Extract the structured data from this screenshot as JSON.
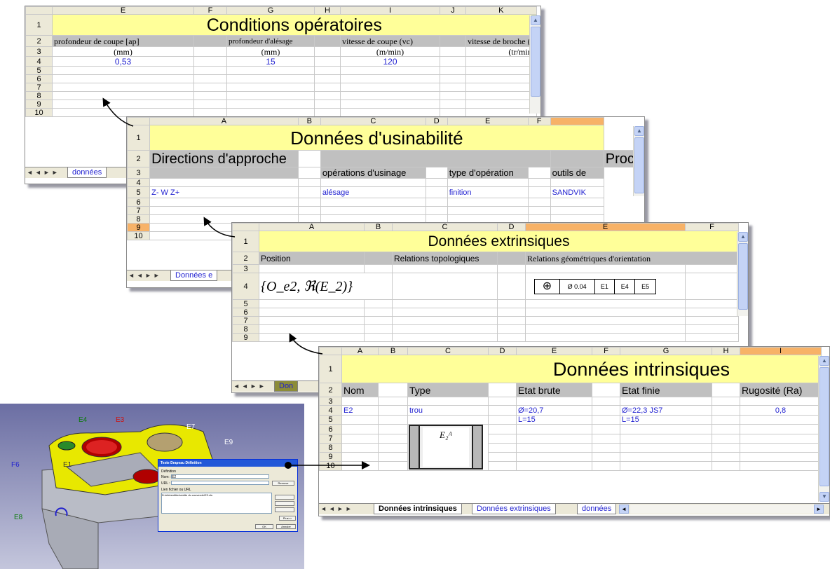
{
  "sheet1": {
    "columns": [
      "E",
      "F",
      "G",
      "H",
      "I",
      "J",
      "K"
    ],
    "rows": [
      "1",
      "2",
      "3",
      "4",
      "5",
      "6",
      "7",
      "8",
      "9",
      "10"
    ],
    "title": "Conditions opératoires",
    "headers": [
      "profondeur de coupe [ap]",
      "profondeur d'alésage",
      "vitesse de coupe (vc)",
      "vitesse de broche (n"
    ],
    "units": [
      "(mm)",
      "(mm)",
      "(m/min)",
      "(tr/min)"
    ],
    "values": [
      "0,53",
      "15",
      "120",
      ""
    ],
    "tab_label": "données"
  },
  "sheet2": {
    "columns": [
      "A",
      "B",
      "C",
      "D",
      "E",
      "F",
      ""
    ],
    "rows": [
      "1",
      "2",
      "3",
      "4",
      "5",
      "6",
      "7",
      "8",
      "9",
      "10"
    ],
    "title": "Données d'usinabilité",
    "directions_label": "Directions d'approche",
    "process_label": "Proce",
    "subheaders": [
      "opérations d'usinage",
      "type d'opération",
      "outils de"
    ],
    "row5": [
      "Z- W Z+",
      "alésage",
      "finition",
      "SANDVIK"
    ],
    "tab_label": "Données e"
  },
  "sheet3": {
    "columns": [
      "A",
      "B",
      "C",
      "D",
      "E",
      "F"
    ],
    "rows": [
      "1",
      "2",
      "3",
      "4",
      "5",
      "6",
      "7",
      "8",
      "9",
      "10"
    ],
    "title": "Données extrinsiques",
    "headers": [
      "Position",
      "Relations topologiques",
      "Relations géométriques d'orientation"
    ],
    "formula": "{O_e2, ℜ(E_2)}",
    "tolerance": {
      "symbol": "⊕",
      "value": "Ø 0.04",
      "refs": [
        "E1",
        "E4",
        "E5"
      ]
    },
    "tab_label": "Don"
  },
  "sheet4": {
    "columns": [
      "A",
      "B",
      "C",
      "D",
      "E",
      "F",
      "G",
      "H",
      "I"
    ],
    "rows": [
      "1",
      "2",
      "3",
      "4",
      "5",
      "6",
      "7",
      "8",
      "9",
      "10"
    ],
    "title": "Données intrinsiques",
    "headers": [
      "Nom",
      "Type",
      "Etat brute",
      "Etat finie",
      "Rugosité (Ra)"
    ],
    "row4": [
      "E2",
      "trou",
      "Ø=20,7",
      "Ø=22,3 JS7",
      "0,8"
    ],
    "row5": [
      "L=15",
      "L=15"
    ],
    "figure_label": "E₂ᴬ",
    "tabs": [
      "Données intrinsiques",
      "Données extrinsiques",
      "données"
    ]
  },
  "cad": {
    "labels": [
      "E4",
      "E3",
      "E7",
      "E9",
      "F6",
      "E1",
      "E8"
    ],
    "dialog": {
      "title": "Texte Drapeau Définition",
      "section": "Définition",
      "nom_label": "Nom :",
      "nom_value": "E2",
      "url_label": "URL :",
      "remove_button": "Remove",
      "list_label": "Lien fichier ou URL",
      "path": "D:\\etie\\entities\\entite du couvercle\\E2.xls",
      "more_button": "Plus>>",
      "ok_button": "OK",
      "cancel_button": "Annuler"
    }
  },
  "colors": {
    "title_bg": "#ffff99",
    "header_bg": "#c0c0c0",
    "selected_col": "#f7b267",
    "link_blue": "#1f1fd0",
    "cad_bg": "#7577a8",
    "part_yellow": "#e8e800",
    "part_red": "#cc1111"
  }
}
